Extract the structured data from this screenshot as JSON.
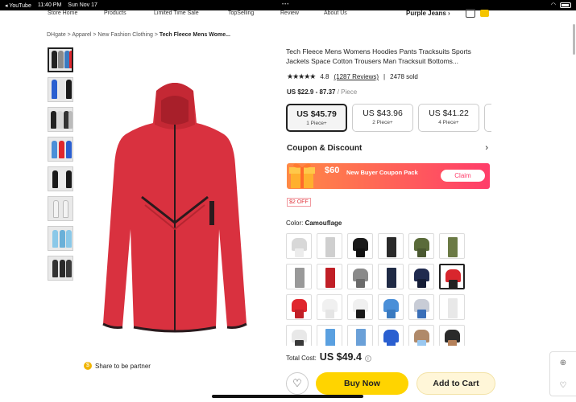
{
  "status_bar": {
    "app": "◂ YouTube",
    "time": "11:40 PM",
    "date": "Sun Nov 17"
  },
  "nav": {
    "items": [
      "Store Home",
      "Products",
      "Limited Time Sale",
      "TopSelling",
      "Review",
      "About Us"
    ],
    "brand": "Purple Jeans"
  },
  "breadcrumb": {
    "path": "DHgate > Apparel > New Fashion Clothing > ",
    "current": "Tech Fleece Mens Wome..."
  },
  "product": {
    "title": "Tech Fleece Mens Womens Hoodies Pants Tracksuits Sports Jackets Space Cotton Trousers Man Tracksuit Bottoms...",
    "stars": "★★★★★",
    "rating": "4.8",
    "reviews": "(1287 Reviews)",
    "sold": "2478 sold",
    "price_range": "US $22.9 - 87.37",
    "price_unit": "/ Piece",
    "tiers": [
      {
        "price": "US $45.79",
        "qty": "1 Piece+"
      },
      {
        "price": "US $43.96",
        "qty": "2 Piece+"
      },
      {
        "price": "US $41.22",
        "qty": "4 Piece+"
      },
      {
        "price": "",
        "qty": "1("
      }
    ]
  },
  "coupon": {
    "heading": "Coupon & Discount",
    "amount": "$60",
    "text": "New Buyer Coupon Pack",
    "claim": "Claim",
    "badge": "$2 OFF"
  },
  "color": {
    "label": "Color:",
    "value": "Camouflage"
  },
  "swatch_colors": [
    [
      "#d8d8d8",
      "#ececec",
      ""
    ],
    [
      "#cfcfcf",
      "#cfcfcf",
      "pants"
    ],
    [
      "#1a1a1a",
      "#111",
      ""
    ],
    [
      "#2a2a2a",
      "#2a2a2a",
      "pants"
    ],
    [
      "#5a6b3a",
      "#4a5830",
      ""
    ],
    [
      "#6b7a45",
      "#6b7a45",
      "pants"
    ],
    [
      "#b5b5b5",
      "#999",
      "pants"
    ],
    [
      "#d8262d",
      "#c01f26",
      "pants"
    ],
    [
      "#8a8a8a",
      "#6a6a6a",
      ""
    ],
    [
      "#1f2a45",
      "#1f2a45",
      "pants"
    ],
    [
      "#1f2a4f",
      "#141c36",
      ""
    ],
    [
      "#d8262d",
      "#222",
      ""
    ],
    [
      "#e0262d",
      "#c01f26",
      ""
    ],
    [
      "#f0f0f0",
      "#e5e5e5",
      ""
    ],
    [
      "#f0f0f0",
      "#1a1a1a",
      ""
    ],
    [
      "#4a8fd8",
      "#3a7ac0",
      ""
    ],
    [
      "#c8ccd6",
      "#3a6fb8",
      ""
    ],
    [
      "#e8e8e8",
      "#e8e8e8",
      "pants"
    ],
    [
      "#e8e8e8",
      "#3a3a3a",
      ""
    ],
    [
      "#5aa0e0",
      "#5aa0e0",
      "pants"
    ],
    [
      "#6aa0d8",
      "#6aa0d8",
      "pants"
    ],
    [
      "#2a5fd0",
      "#2a5fd0",
      ""
    ],
    [
      "#b08a6a",
      "#9ac8f0",
      ""
    ],
    [
      "#2a2a2a",
      "#b5815a",
      ""
    ]
  ],
  "total": {
    "label": "Total Cost:",
    "value": "US $49.4"
  },
  "actions": {
    "fav": "♡",
    "buy": "Buy Now",
    "add": "Add to Cart"
  },
  "share": "Share to be partner",
  "side_tools": [
    "⊕",
    "♡"
  ]
}
